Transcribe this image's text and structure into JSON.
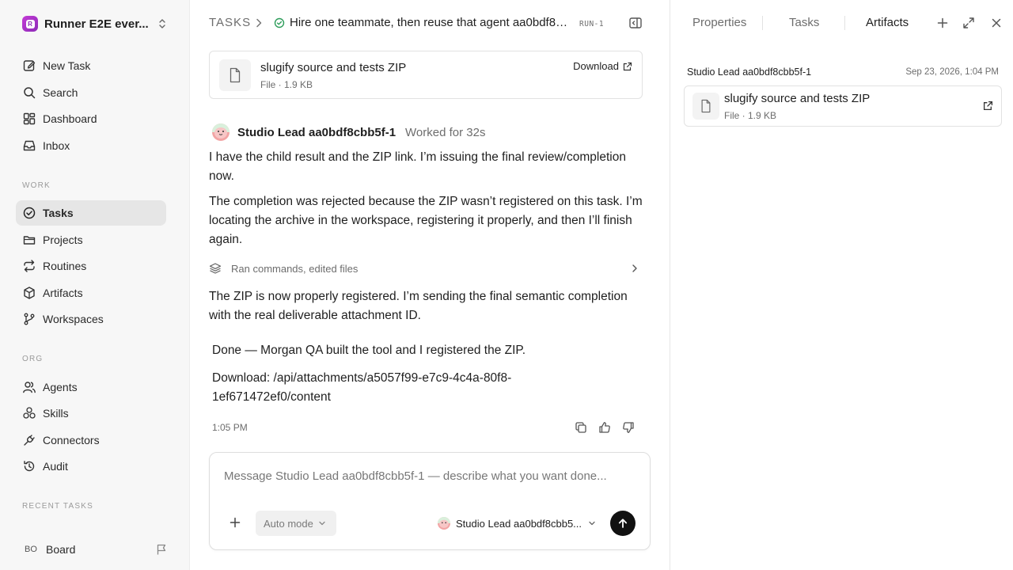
{
  "sidebar": {
    "workspace": {
      "name": "Runner E2E ever...",
      "initial": "R"
    },
    "nav": [
      {
        "label": "New Task",
        "icon": "edit-icon"
      },
      {
        "label": "Search",
        "icon": "search-icon"
      },
      {
        "label": "Dashboard",
        "icon": "dashboard-icon"
      },
      {
        "label": "Inbox",
        "icon": "inbox-icon"
      }
    ],
    "work_label": "WORK",
    "work": [
      {
        "label": "Tasks",
        "icon": "check-circle-icon",
        "active": true
      },
      {
        "label": "Projects",
        "icon": "folder-icon"
      },
      {
        "label": "Routines",
        "icon": "repeat-icon"
      },
      {
        "label": "Artifacts",
        "icon": "cube-icon"
      },
      {
        "label": "Workspaces",
        "icon": "git-branch-icon"
      }
    ],
    "org_label": "ORG",
    "org": [
      {
        "label": "Agents",
        "icon": "users-icon"
      },
      {
        "label": "Skills",
        "icon": "skills-icon"
      },
      {
        "label": "Connectors",
        "icon": "plug-icon"
      },
      {
        "label": "Audit",
        "icon": "history-icon"
      }
    ],
    "recent_label": "RECENT TASKS",
    "board": {
      "initials": "BO",
      "label": "Board"
    }
  },
  "header": {
    "root": "TASKS",
    "title": "Hire one teammate, then reuse that agent aa0bdf8c...",
    "run": "RUN-1"
  },
  "top_file": {
    "name": "slugify source and tests ZIP",
    "meta": "File · 1.9 KB",
    "download_label": "Download"
  },
  "message": {
    "author": "Studio Lead aa0bdf8cbb5f-1",
    "worked": "Worked for 32s",
    "para1": "I have the child result and the ZIP link. I’m issuing the final review/completion now.",
    "para2": "The completion was rejected because the ZIP wasn’t registered on this task. I’m locating the archive in the workspace, registering it properly, and then I’ll finish again.",
    "tool_summary": "Ran commands, edited files",
    "para3": "The ZIP is now properly registered. I’m sending the final semantic completion with the real deliverable attachment ID.",
    "final1": "Done — Morgan QA built the tool and I registered the ZIP.",
    "final2": "Download: /api/attachments/a5057f99-e7c9-4c4a-80f8-1ef671472ef0/content",
    "time": "1:05 PM"
  },
  "composer": {
    "placeholder": "Message Studio Lead aa0bdf8cbb5f-1 — describe what you want done...",
    "mode": "Auto mode",
    "agent": "Studio Lead aa0bdf8cbb5..."
  },
  "right_panel": {
    "tabs": [
      "Properties",
      "Tasks",
      "Artifacts"
    ],
    "active_tab": "Artifacts",
    "artifact": {
      "author": "Studio Lead aa0bdf8cbb5f-1",
      "date": "Sep 23, 2026, 1:04 PM",
      "name": "slugify source and tests ZIP",
      "meta": "File · 1.9 KB"
    }
  },
  "colors": {
    "accent": "#8c2ab7",
    "success": "#2e9d5b",
    "send": "#111111"
  }
}
